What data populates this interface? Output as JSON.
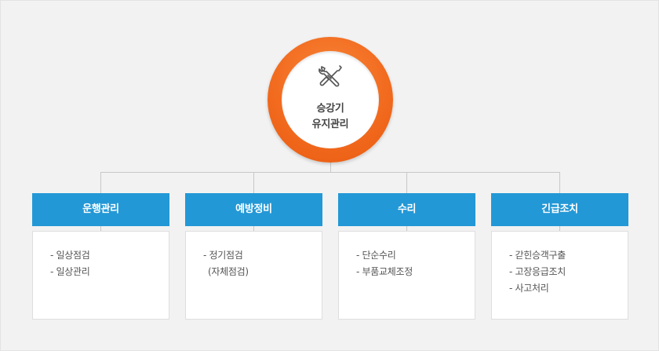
{
  "center": {
    "icon": "wrench-screwdriver-icon",
    "title_line1": "승강기",
    "title_line2": "유지관리",
    "accent_color": "#f26b1f"
  },
  "header_color": "#2398d6",
  "columns": [
    {
      "title": "운행관리",
      "items": [
        "- 일상점검",
        "- 일상관리"
      ]
    },
    {
      "title": "예방정비",
      "items": [
        "- 정기점검",
        "(자체점검)"
      ]
    },
    {
      "title": "수리",
      "items": [
        "- 단순수리",
        "- 부품교체조정"
      ]
    },
    {
      "title": "긴급조치",
      "items": [
        "- 갇힌승객구출",
        "- 고장응급조치",
        "- 사고처리"
      ]
    }
  ]
}
